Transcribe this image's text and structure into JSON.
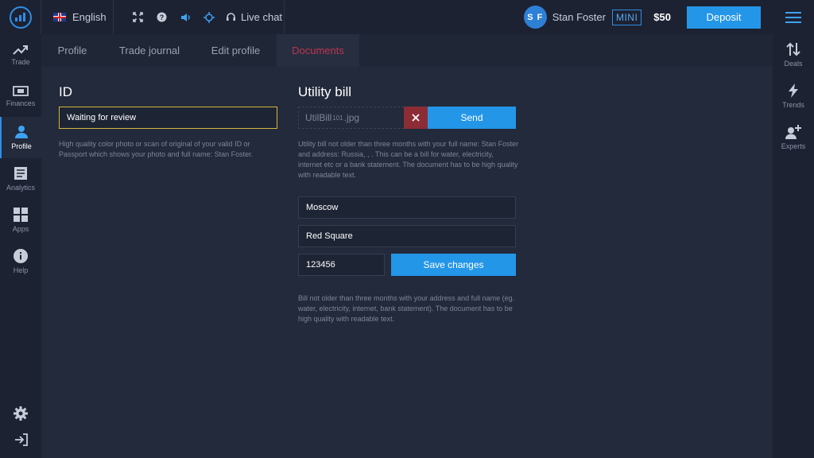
{
  "header": {
    "language": "English",
    "livechat_label": "Live chat",
    "user": {
      "initials": "S F",
      "name": "Stan Foster",
      "account_type": "MINI",
      "balance": "$50"
    },
    "deposit_label": "Deposit"
  },
  "sidebar_left": {
    "items": [
      {
        "label": "Trade",
        "icon": "trend-up-icon"
      },
      {
        "label": "Finances",
        "icon": "banknote-icon"
      },
      {
        "label": "Profile",
        "icon": "user-icon",
        "active": true
      },
      {
        "label": "Analytics",
        "icon": "document-icon"
      },
      {
        "label": "Apps",
        "icon": "grid-icon"
      },
      {
        "label": "Help",
        "icon": "info-icon"
      }
    ],
    "bottom": [
      "gear-icon",
      "logout-icon"
    ]
  },
  "sidebar_right": {
    "items": [
      {
        "label": "Deals",
        "icon": "sort-arrows-icon"
      },
      {
        "label": "Trends",
        "icon": "lightning-icon"
      },
      {
        "label": "Experts",
        "icon": "add-user-icon"
      }
    ]
  },
  "tabs": [
    "Profile",
    "Trade journal",
    "Edit profile",
    "Documents"
  ],
  "active_tab": "Documents",
  "id_section": {
    "title": "ID",
    "status": "Waiting for review",
    "hint": "High quality color photo or scan of original of your valid ID or Passport which shows your photo and full name: Stan Foster."
  },
  "utility_section": {
    "title": "Utility bill",
    "file_name_start": "UtilBill",
    "file_name_small": "101",
    "file_name_end": ".jpg",
    "send_label": "Send",
    "hint": "Utility bill not older than three months with your full name: Stan Foster and address: Russia, , . This can be a bill for water, electricity, internet etc or a bank statement. The document has to be high quality with readable text.",
    "city": "Moscow",
    "street": "Red Square",
    "zip": "123456",
    "save_label": "Save changes",
    "hint2": "Bill not older than three months with your address and full name (eg. water, electricity, internet, bank statement). The document has to be high quality with readable text."
  },
  "colors": {
    "accent": "#2496e8",
    "active_tab": "#c0344f",
    "status_border": "#d8b43a",
    "danger": "#8c2d36"
  }
}
